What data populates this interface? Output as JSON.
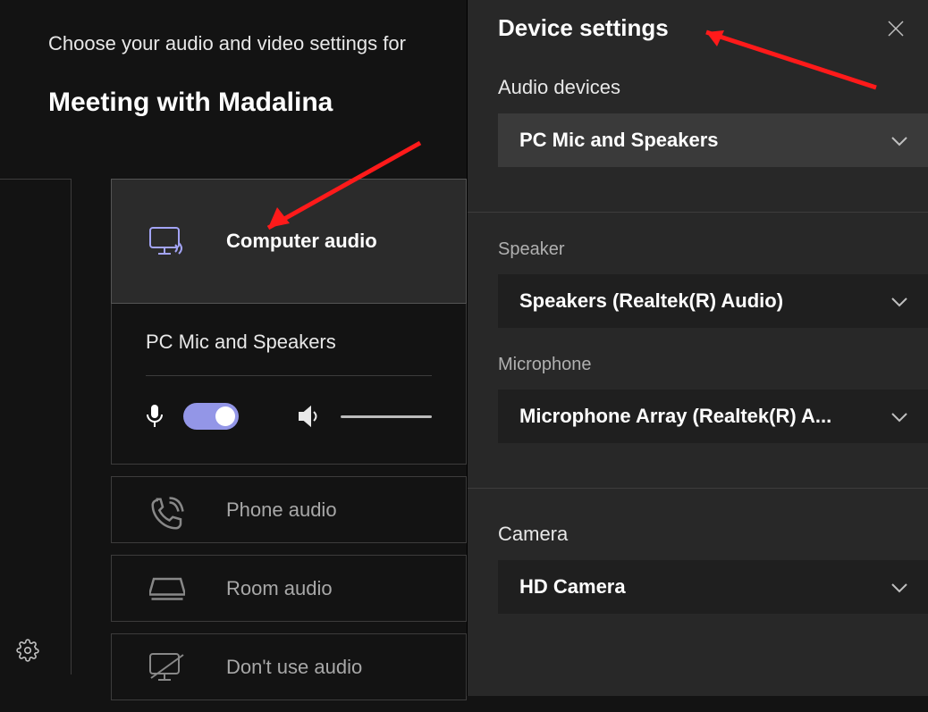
{
  "prejoin": {
    "choose_label": "Choose your audio and video settings for",
    "meeting_title": "Meeting with Madalina",
    "options": {
      "computer_audio": "Computer audio",
      "phone_audio": "Phone audio",
      "room_audio": "Room audio",
      "dont_use_audio": "Don't use audio"
    },
    "computer_sub": {
      "device_label": "PC Mic and Speakers"
    }
  },
  "device_settings": {
    "title": "Device settings",
    "audio_devices": {
      "label": "Audio devices",
      "selected": "PC Mic and Speakers"
    },
    "speaker": {
      "label": "Speaker",
      "selected": "Speakers (Realtek(R) Audio)"
    },
    "microphone": {
      "label": "Microphone",
      "selected": "Microphone Array (Realtek(R) A..."
    },
    "camera": {
      "label": "Camera",
      "selected": "HD Camera"
    }
  }
}
